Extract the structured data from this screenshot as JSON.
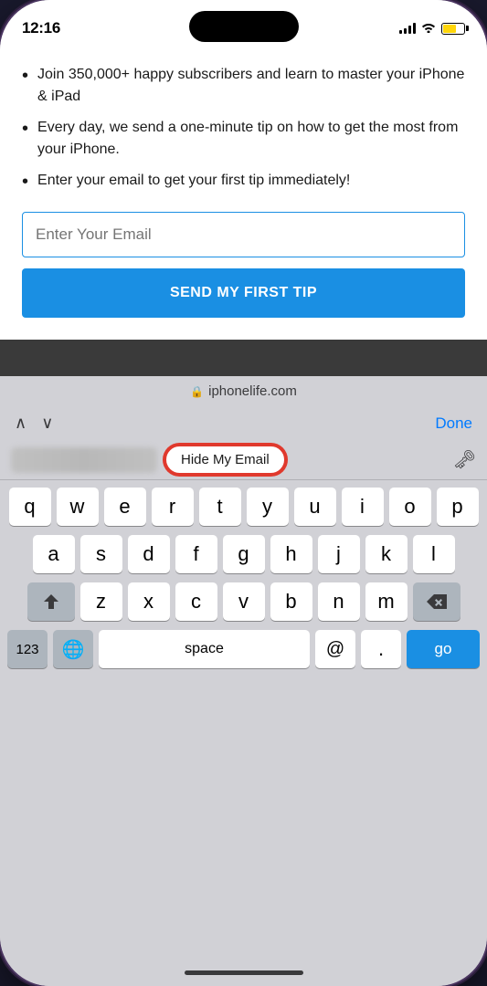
{
  "status": {
    "time": "12:16",
    "domain": "iphonelife.com"
  },
  "content": {
    "bullets": [
      "Join 350,000+ happy subscribers and learn to master your iPhone & iPad",
      "Every day, we send a one-minute tip on how to get the most from your iPhone.",
      "Enter your email to get your first tip immediately!"
    ],
    "email_placeholder": "Enter Your Email",
    "submit_button": "SEND MY FIRST TIP"
  },
  "keyboard_toolbar": {
    "done_label": "Done",
    "hide_email_label": "Hide My Email"
  },
  "keyboard": {
    "row1": [
      "q",
      "w",
      "e",
      "r",
      "t",
      "y",
      "u",
      "i",
      "o",
      "p"
    ],
    "row2": [
      "a",
      "s",
      "d",
      "f",
      "g",
      "h",
      "j",
      "k",
      "l"
    ],
    "row3": [
      "z",
      "x",
      "c",
      "v",
      "b",
      "n",
      "m"
    ],
    "space_label": "space",
    "go_label": "go",
    "numbers_label": "123"
  },
  "colors": {
    "accent_blue": "#1a8fe3",
    "done_blue": "#007aff",
    "red_circle": "#e0392d"
  }
}
